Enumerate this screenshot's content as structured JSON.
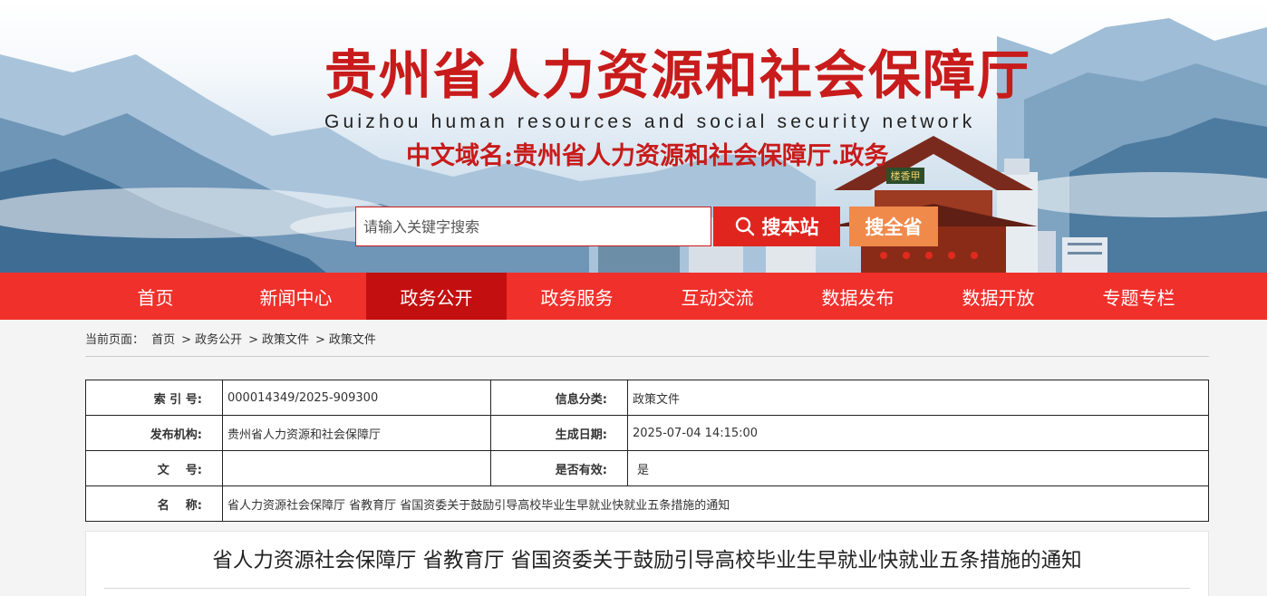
{
  "header": {
    "title": "贵州省人力资源和社会保障厅",
    "subtitle": "Guizhou human resources and social security network",
    "domain": "中文域名:贵州省人力资源和社会保障厅.政务",
    "tower_sign": "楼香甲"
  },
  "search": {
    "placeholder": "请输入关键字搜索",
    "site_button": "搜本站",
    "province_button": "搜全省"
  },
  "nav": {
    "items": [
      "首页",
      "新闻中心",
      "政务公开",
      "政务服务",
      "互动交流",
      "数据发布",
      "数据开放",
      "专题专栏"
    ],
    "active": "政务公开"
  },
  "breadcrumb": {
    "prefix": "当前页面：",
    "items": [
      "首页",
      "政务公开",
      "政策文件",
      "政策文件"
    ],
    "separator": ">"
  },
  "meta": {
    "index_label": "索 引 号:",
    "index_value": "000014349/2025-909300",
    "category_label": "信息分类:",
    "category_value": "政策文件",
    "publisher_label": "发布机构:",
    "publisher_value": "贵州省人力资源和社会保障厅",
    "date_label": "生成日期:",
    "date_value": "2025-07-04 14:15:00",
    "docno_label": "文    号:",
    "docno_value": "",
    "valid_label": "是否有效:",
    "valid_value": "是",
    "name_label": "名    称:",
    "name_value": "省人力资源社会保障厅 省教育厅 省国资委关于鼓励引导高校毕业生早就业快就业五条措施的通知"
  },
  "article": {
    "title": "省人力资源社会保障厅 省教育厅 省国资委关于鼓励引导高校毕业生早就业快就业五条措施的通知"
  },
  "colors": {
    "brand_red": "#c81b1b",
    "nav_red": "#f0302b",
    "nav_active": "#c30f0f",
    "search_orange": "#f08a4b"
  }
}
